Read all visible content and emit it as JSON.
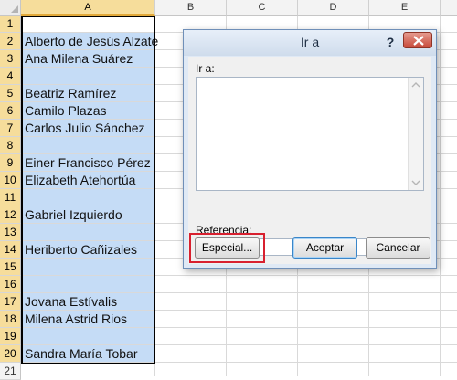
{
  "sheet": {
    "columns": [
      "A",
      "B",
      "C",
      "D",
      "E"
    ],
    "rows": [
      "1",
      "2",
      "3",
      "4",
      "5",
      "6",
      "7",
      "8",
      "9",
      "10",
      "11",
      "12",
      "13",
      "14",
      "15",
      "16",
      "17",
      "18",
      "19",
      "20",
      "21"
    ],
    "cells": {
      "r2": "Alberto de Jesús Alzate",
      "r3": "Ana Milena Suárez",
      "r5": "Beatriz Ramírez",
      "r6": "Camilo Plazas",
      "r7": "Carlos Julio Sánchez",
      "r9": "Einer Francisco Pérez",
      "r10": "Elizabeth Atehortúa",
      "r12": "Gabriel Izquierdo",
      "r14": "Heriberto Cañizales",
      "r17": "Jovana Estívalis",
      "r18": "Milena Astrid Rios",
      "r20": "Sandra María Tobar"
    },
    "selection_color": "#c5dcf6"
  },
  "dialog": {
    "title": "Ir a",
    "help_label": "?",
    "goto_label": "Ir a:",
    "reference_label": "Referencia:",
    "reference_value": "",
    "special_button": "Especial...",
    "accept_button": "Aceptar",
    "cancel_button": "Cancelar",
    "icons": {
      "close": "close-icon",
      "scroll_up": "chevron-up-icon",
      "scroll_down": "chevron-down-icon"
    },
    "highlight_color": "#d8202f"
  }
}
